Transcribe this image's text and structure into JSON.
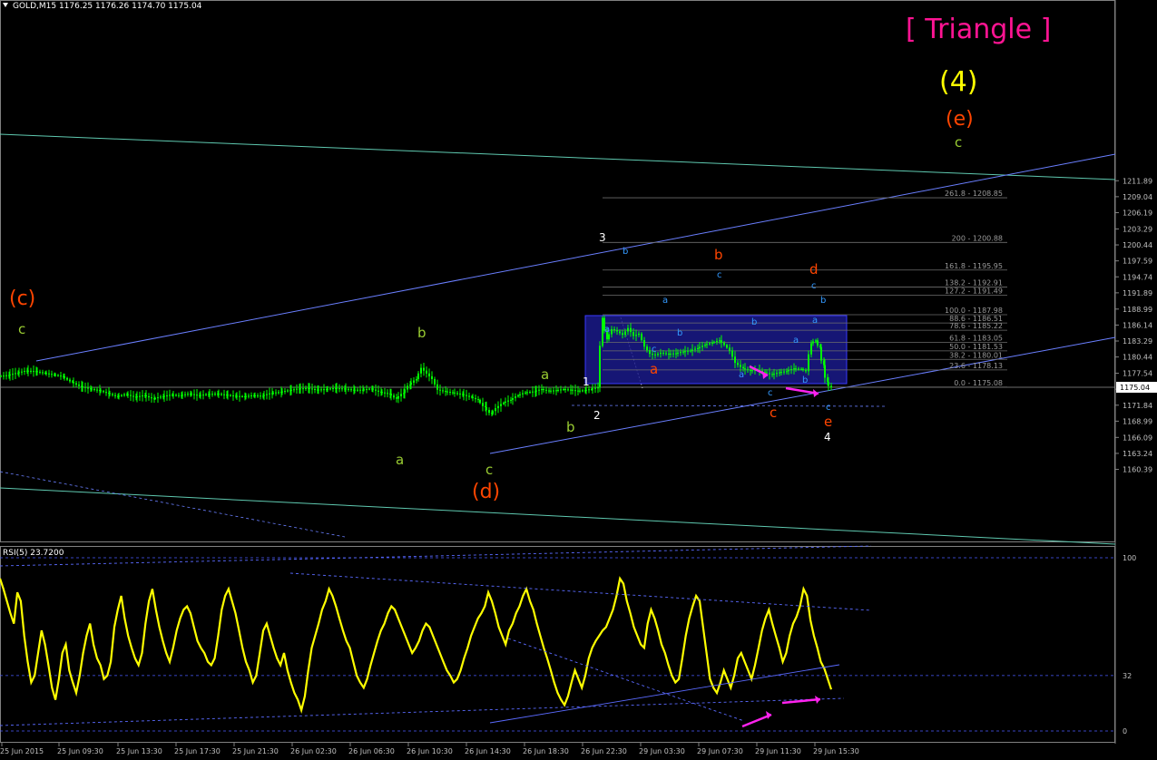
{
  "header": {
    "symbol_info": "GOLD,M15  1176.25 1176.26 1174.70 1175.04",
    "rsi_label": "RSI(5) 23.7200"
  },
  "colors": {
    "background": "#000000",
    "candle": "#00ff00",
    "rsi_line": "#ffff00",
    "channel": "#6a7fff",
    "teal_line": "#5fc9b0",
    "box_fill": "#1a1a8a",
    "wave_green": "#9acd32",
    "wave_red": "#ff4500",
    "wave_yellow": "#ffff00",
    "wave_blue": "#3399ff",
    "wave_white": "#ffffff",
    "triangle_label": "#ff1493",
    "fib_text": "#9a9a9a",
    "arrow": "#ff22ee"
  },
  "chart_data": [
    {
      "type": "candlestick",
      "symbol": "GOLD",
      "timeframe": "M15",
      "quote": {
        "open": 1176.25,
        "high": 1176.26,
        "low": 1174.7,
        "close": 1175.04
      },
      "current_price": "1175.04",
      "ylim": [
        1159.5,
        1212.5
      ],
      "y_ticks": [
        "1211.89",
        "1209.04",
        "1206.19",
        "1203.29",
        "1200.44",
        "1197.59",
        "1194.74",
        "1191.89",
        "1188.99",
        "1186.14",
        "1183.29",
        "1180.44",
        "1177.54",
        "1174.69",
        "1171.84",
        "1168.99",
        "1166.09",
        "1163.24",
        "1160.39"
      ],
      "x_ticks": [
        "25 Jun 2015",
        "25 Jun 09:30",
        "25 Jun 13:30",
        "25 Jun 17:30",
        "25 Jun 21:30",
        "26 Jun 02:30",
        "26 Jun 06:30",
        "26 Jun 10:30",
        "26 Jun 14:30",
        "26 Jun 18:30",
        "26 Jun 22:30",
        "29 Jun 03:30",
        "29 Jun 07:30",
        "29 Jun 11:30",
        "29 Jun 15:30"
      ],
      "price_path": [
        [
          0,
          1177.0
        ],
        [
          10,
          1177.2
        ],
        [
          20,
          1177.6
        ],
        [
          30,
          1178.0
        ],
        [
          40,
          1177.9
        ],
        [
          50,
          1177.6
        ],
        [
          60,
          1177.3
        ],
        [
          70,
          1177.0
        ],
        [
          80,
          1176.0
        ],
        [
          90,
          1175.2
        ],
        [
          100,
          1174.8
        ],
        [
          110,
          1174.5
        ],
        [
          120,
          1174.0
        ],
        [
          130,
          1173.4
        ],
        [
          140,
          1173.8
        ],
        [
          150,
          1173.3
        ],
        [
          160,
          1173.6
        ],
        [
          170,
          1173.0
        ],
        [
          180,
          1173.4
        ],
        [
          190,
          1173.7
        ],
        [
          200,
          1173.6
        ],
        [
          210,
          1173.9
        ],
        [
          220,
          1173.6
        ],
        [
          230,
          1173.8
        ],
        [
          240,
          1173.9
        ],
        [
          250,
          1173.7
        ],
        [
          260,
          1173.5
        ],
        [
          270,
          1173.4
        ],
        [
          280,
          1173.6
        ],
        [
          290,
          1173.5
        ],
        [
          300,
          1174.0
        ],
        [
          310,
          1174.2
        ],
        [
          320,
          1174.5
        ],
        [
          330,
          1174.8
        ],
        [
          340,
          1174.9
        ],
        [
          350,
          1174.6
        ],
        [
          360,
          1174.7
        ],
        [
          370,
          1174.9
        ],
        [
          380,
          1174.8
        ],
        [
          390,
          1174.6
        ],
        [
          400,
          1174.6
        ],
        [
          410,
          1174.8
        ],
        [
          420,
          1174.2
        ],
        [
          430,
          1173.9
        ],
        [
          438,
          1173.0
        ],
        [
          445,
          1174.0
        ],
        [
          452,
          1175.5
        ],
        [
          460,
          1176.5
        ],
        [
          466,
          1178.5
        ],
        [
          472,
          1177.5
        ],
        [
          478,
          1176.5
        ],
        [
          484,
          1174.6
        ],
        [
          492,
          1174.3
        ],
        [
          500,
          1174.1
        ],
        [
          510,
          1173.8
        ],
        [
          520,
          1173.3
        ],
        [
          528,
          1172.8
        ],
        [
          535,
          1171.5
        ],
        [
          542,
          1170.3
        ],
        [
          548,
          1171.3
        ],
        [
          556,
          1172.3
        ],
        [
          564,
          1172.8
        ],
        [
          572,
          1173.6
        ],
        [
          580,
          1174.1
        ],
        [
          590,
          1174.3
        ],
        [
          598,
          1174.7
        ],
        [
          606,
          1174.4
        ],
        [
          614,
          1174.5
        ],
        [
          622,
          1174.7
        ],
        [
          630,
          1174.6
        ],
        [
          638,
          1174.4
        ],
        [
          645,
          1174.5
        ],
        [
          652,
          1174.7
        ],
        [
          660,
          1175.0
        ],
        [
          665,
          1187.4
        ],
        [
          670,
          1183.6
        ],
        [
          676,
          1185.4
        ],
        [
          682,
          1185.0
        ],
        [
          688,
          1184.4
        ],
        [
          694,
          1185.6
        ],
        [
          700,
          1184.2
        ],
        [
          706,
          1184.6
        ],
        [
          712,
          1182.3
        ],
        [
          718,
          1181.0
        ],
        [
          724,
          1180.8
        ],
        [
          730,
          1181.2
        ],
        [
          738,
          1181.0
        ],
        [
          746,
          1181.1
        ],
        [
          754,
          1181.4
        ],
        [
          762,
          1181.6
        ],
        [
          770,
          1182.0
        ],
        [
          778,
          1182.6
        ],
        [
          786,
          1183.0
        ],
        [
          794,
          1183.4
        ],
        [
          800,
          1182.6
        ],
        [
          806,
          1181.6
        ],
        [
          812,
          1179.4
        ],
        [
          820,
          1178.4
        ],
        [
          828,
          1178.0
        ],
        [
          836,
          1178.2
        ],
        [
          844,
          1177.7
        ],
        [
          852,
          1177.3
        ],
        [
          860,
          1177.7
        ],
        [
          868,
          1177.9
        ],
        [
          876,
          1178.4
        ],
        [
          884,
          1178.3
        ],
        [
          890,
          1177.9
        ],
        [
          895,
          1182.9
        ],
        [
          900,
          1183.4
        ],
        [
          904,
          1182.2
        ],
        [
          908,
          1179.0
        ],
        [
          912,
          1176.0
        ],
        [
          916,
          1175.04
        ]
      ],
      "fib_levels": [
        {
          "label": "261.8 - 1208.85",
          "value": 1208.85
        },
        {
          "label": "200 - 1200.88",
          "value": 1200.88
        },
        {
          "label": "161.8 - 1195.95",
          "value": 1195.95
        },
        {
          "label": "138.2 - 1192.91",
          "value": 1192.91
        },
        {
          "label": "127.2 - 1191.49",
          "value": 1191.49
        },
        {
          "label": "100.0 - 1187.98",
          "value": 1187.98
        },
        {
          "label": "88.6 - 1186.51",
          "value": 1186.51
        },
        {
          "label": "78.6 - 1185.22",
          "value": 1185.22
        },
        {
          "label": "61.8 - 1183.05",
          "value": 1183.05
        },
        {
          "label": "50.0 - 1181.53",
          "value": 1181.53
        },
        {
          "label": "38.2 - 1180.01",
          "value": 1180.01
        },
        {
          "label": "23.6 - 1178.13",
          "value": 1178.13
        },
        {
          "label": "0.0 - 1175.08",
          "value": 1175.08
        }
      ],
      "wave_labels": [
        {
          "text": "[ Triangle ]",
          "color": "triangle_label",
          "size": "xl"
        },
        {
          "text": "(4)",
          "color": "wave_yellow",
          "size": "xl"
        },
        {
          "text": "(e)",
          "color": "wave_red",
          "size": "lg"
        },
        {
          "text": "c",
          "color": "wave_green",
          "size": "md"
        },
        {
          "text": "(c)",
          "color": "wave_red",
          "size": "lg"
        },
        {
          "text": "c",
          "color": "wave_green",
          "size": "md"
        },
        {
          "text": "b",
          "color": "wave_green",
          "size": "md"
        },
        {
          "text": "a",
          "color": "wave_green",
          "size": "md"
        },
        {
          "text": "c",
          "color": "wave_green",
          "size": "md"
        },
        {
          "text": "(d)",
          "color": "wave_red",
          "size": "lg"
        },
        {
          "text": "a",
          "color": "wave_green",
          "size": "md"
        },
        {
          "text": "b",
          "color": "wave_green",
          "size": "md"
        },
        {
          "text": "1",
          "color": "wave_white",
          "size": "sm"
        },
        {
          "text": "2",
          "color": "wave_white",
          "size": "sm"
        },
        {
          "text": "3",
          "color": "wave_white",
          "size": "sm"
        },
        {
          "text": "4",
          "color": "wave_white",
          "size": "sm"
        },
        {
          "text": "a",
          "color": "wave_red",
          "size": "md"
        },
        {
          "text": "b",
          "color": "wave_red",
          "size": "md"
        },
        {
          "text": "c",
          "color": "wave_red",
          "size": "md"
        },
        {
          "text": "d",
          "color": "wave_red",
          "size": "md"
        },
        {
          "text": "e",
          "color": "wave_red",
          "size": "md"
        },
        {
          "text": "a",
          "color": "wave_blue",
          "size": "xs"
        },
        {
          "text": "b",
          "color": "wave_blue",
          "size": "xs"
        },
        {
          "text": "c",
          "color": "wave_blue",
          "size": "xs"
        },
        {
          "text": "a",
          "color": "wave_blue",
          "size": "xs"
        },
        {
          "text": "b",
          "color": "wave_blue",
          "size": "xs"
        },
        {
          "text": "c",
          "color": "wave_blue",
          "size": "xs"
        },
        {
          "text": "a",
          "color": "wave_blue",
          "size": "xs"
        },
        {
          "text": "b",
          "color": "wave_blue",
          "size": "xs"
        },
        {
          "text": "c",
          "color": "wave_blue",
          "size": "xs"
        },
        {
          "text": "a",
          "color": "wave_blue",
          "size": "xs"
        },
        {
          "text": "b",
          "color": "wave_blue",
          "size": "xs"
        },
        {
          "text": "c",
          "color": "wave_blue",
          "size": "xs"
        },
        {
          "text": "a",
          "color": "wave_blue",
          "size": "xs"
        },
        {
          "text": "b",
          "color": "wave_blue",
          "size": "xs"
        },
        {
          "text": "c",
          "color": "wave_blue",
          "size": "xs"
        }
      ]
    },
    {
      "type": "line",
      "name": "RSI(5) 23.7200",
      "ylim": [
        0,
        100
      ],
      "y_ticks": [
        "100",
        "32",
        "0"
      ],
      "values": [
        88,
        82,
        75,
        68,
        62,
        80,
        75,
        55,
        40,
        28,
        32,
        45,
        58,
        50,
        38,
        25,
        18,
        30,
        45,
        50,
        35,
        28,
        22,
        32,
        45,
        55,
        62,
        50,
        42,
        38,
        30,
        32,
        40,
        60,
        70,
        78,
        65,
        55,
        48,
        42,
        38,
        45,
        62,
        75,
        82,
        70,
        60,
        52,
        45,
        40,
        48,
        58,
        65,
        70,
        72,
        68,
        60,
        52,
        48,
        45,
        40,
        38,
        42,
        55,
        70,
        78,
        82,
        75,
        68,
        58,
        48,
        40,
        35,
        28,
        32,
        45,
        58,
        62,
        55,
        48,
        42,
        38,
        45,
        35,
        28,
        22,
        18,
        12,
        20,
        35,
        48,
        55,
        62,
        70,
        75,
        82,
        78,
        72,
        65,
        58,
        52,
        48,
        40,
        32,
        28,
        25,
        30,
        38,
        45,
        52,
        58,
        62,
        68,
        72,
        70,
        65,
        60,
        55,
        50,
        45,
        48,
        52,
        58,
        62,
        60,
        55,
        50,
        45,
        40,
        35,
        32,
        28,
        30,
        35,
        42,
        48,
        55,
        60,
        65,
        68,
        72,
        80,
        75,
        68,
        60,
        55,
        50,
        58,
        62,
        68,
        72,
        78,
        82,
        75,
        70,
        62,
        55,
        48,
        42,
        35,
        28,
        22,
        18,
        15,
        20,
        28,
        35,
        30,
        25,
        32,
        42,
        48,
        52,
        55,
        58,
        60,
        65,
        70,
        78,
        88,
        85,
        75,
        68,
        60,
        55,
        50,
        48,
        62,
        70,
        65,
        58,
        50,
        45,
        38,
        32,
        28,
        30,
        42,
        55,
        65,
        72,
        78,
        75,
        60,
        45,
        30,
        25,
        22,
        28,
        35,
        30,
        25,
        32,
        42,
        45,
        40,
        35,
        30,
        38,
        48,
        58,
        65,
        70,
        62,
        55,
        48,
        40,
        45,
        55,
        62,
        66,
        72,
        82,
        78,
        64,
        55,
        48,
        40,
        36,
        30,
        24
      ]
    }
  ]
}
